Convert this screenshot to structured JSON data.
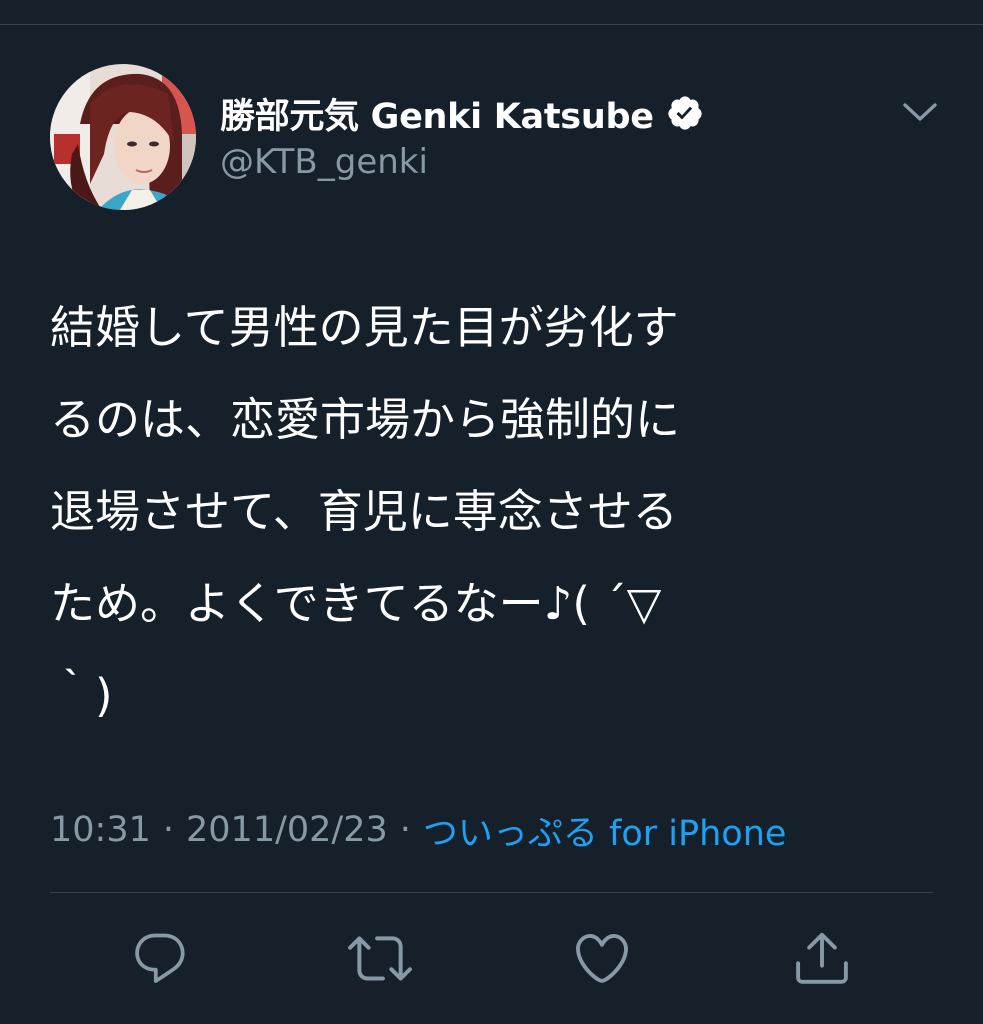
{
  "tweet": {
    "author": {
      "display_name": "勝部元気 Genki Katsube",
      "handle": "@KTB_genki",
      "verified": true
    },
    "text": "結婚して男性の見た目が劣化す\nるのは、恋愛市場から強制的に\n退場させて、育児に専念させる\nため。よくできてるなー♪( ´▽\n｀)",
    "time": "10:31",
    "separator": "·",
    "date": "2011/02/23",
    "source": "ついっぷる for iPhone"
  },
  "actions": [
    {
      "name": "reply",
      "icon": "speech-bubble-icon"
    },
    {
      "name": "retweet",
      "icon": "retweet-icon"
    },
    {
      "name": "like",
      "icon": "heart-icon"
    },
    {
      "name": "share",
      "icon": "share-upload-icon"
    }
  ],
  "colors": {
    "background": "#15202b",
    "divider": "#38444d",
    "primary_text": "#ffffff",
    "secondary_text": "#8899a6",
    "link": "#1da1f2"
  }
}
